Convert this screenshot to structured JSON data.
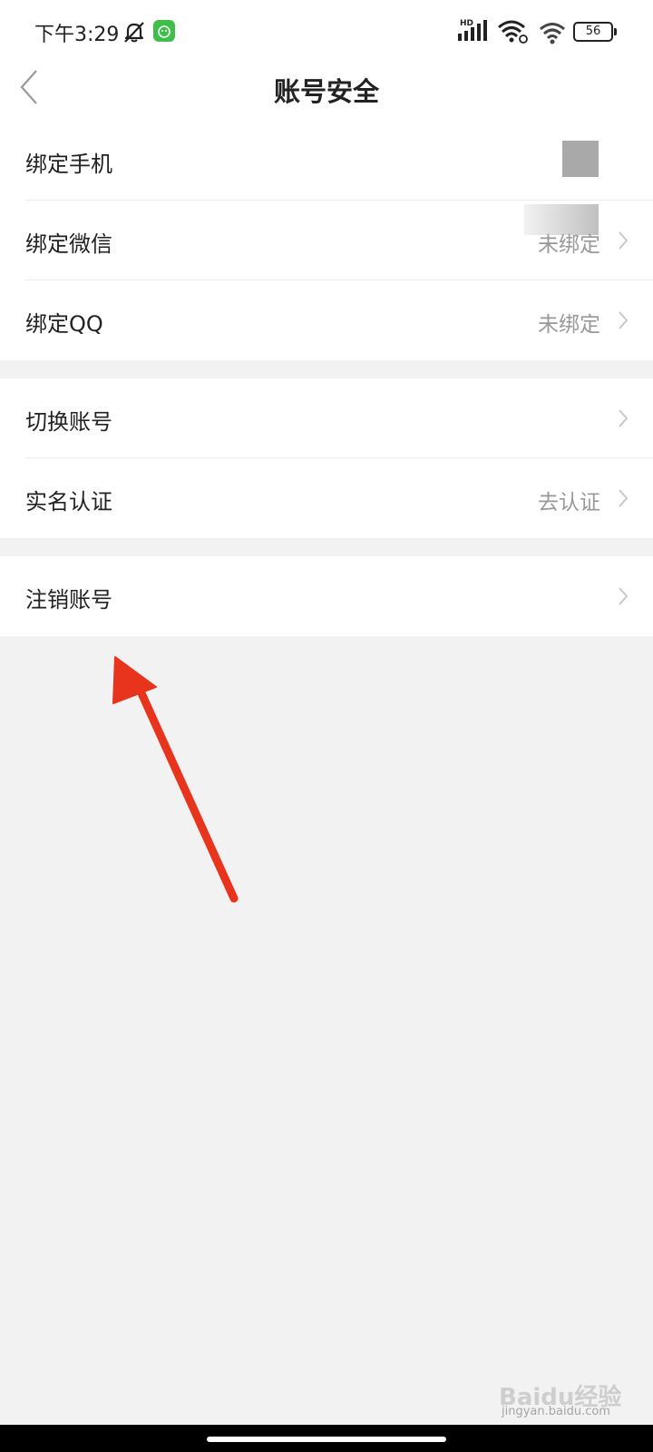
{
  "status_bar": {
    "time": "下午3:29",
    "network_label": "HD",
    "battery": "56",
    "icons": [
      "bell-off-icon",
      "app-notification-icon",
      "signal-icon",
      "wifi-icon",
      "wifi-icon",
      "battery-icon"
    ]
  },
  "nav": {
    "title": "账号安全",
    "back_icon": "chevron-left-icon"
  },
  "groups": [
    {
      "rows": [
        {
          "label": "绑定手机",
          "value": ""
        },
        {
          "label": "绑定微信",
          "value": "未绑定"
        },
        {
          "label": "绑定QQ",
          "value": "未绑定"
        }
      ]
    },
    {
      "rows": [
        {
          "label": "切换账号",
          "value": ""
        },
        {
          "label": "实名认证",
          "value": "去认证"
        }
      ]
    },
    {
      "rows": [
        {
          "label": "注销账号",
          "value": ""
        }
      ]
    }
  ],
  "annotation": {
    "arrow_color": "#e8341c"
  },
  "watermark": {
    "brand": "Baidu经验",
    "url": "jingyan.baidu.com"
  },
  "colors": {
    "background": "#f2f2f2",
    "card": "#ffffff",
    "secondary_text": "#999999"
  }
}
